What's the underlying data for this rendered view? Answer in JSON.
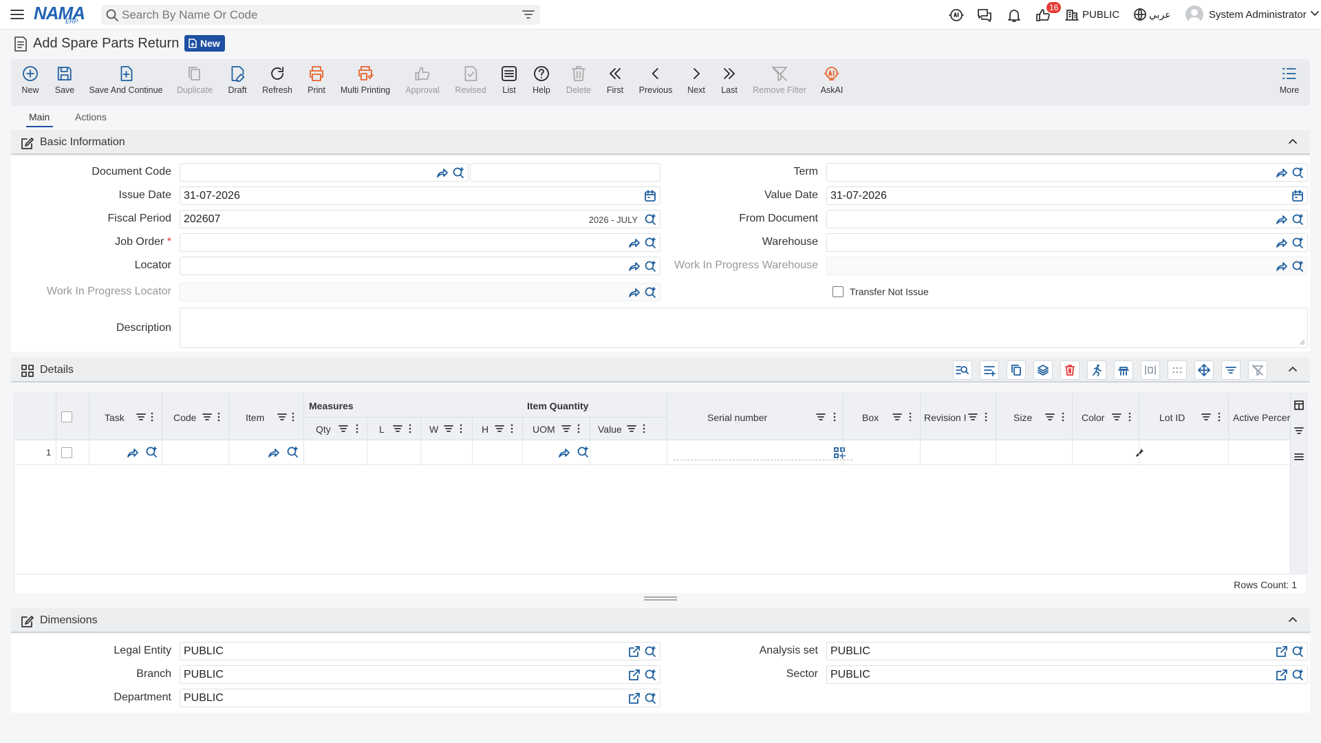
{
  "topbar": {
    "logo_text": "NAMA",
    "logo_sub": "ERP",
    "search_placeholder": "Search By Name Or Code",
    "notification_count": "16",
    "entity_label": "PUBLIC",
    "language_label": "عربي",
    "user_name": "System Administrator"
  },
  "page": {
    "title": "Add Spare Parts Return",
    "status_badge": "New"
  },
  "toolbar": {
    "new": "New",
    "save": "Save",
    "save_continue": "Save And Continue",
    "duplicate": "Duplicate",
    "draft": "Draft",
    "refresh": "Refresh",
    "print": "Print",
    "multi_printing": "Multi Printing",
    "approval": "Approval",
    "revised": "Revised",
    "list": "List",
    "help": "Help",
    "delete": "Delete",
    "first": "First",
    "previous": "Previous",
    "next": "Next",
    "last": "Last",
    "remove_filter": "Remove Filter",
    "askai": "AskAI",
    "more": "More"
  },
  "tabs": {
    "main": "Main",
    "actions": "Actions"
  },
  "basic_info": {
    "title": "Basic Information",
    "document_code_label": "Document Code",
    "document_code": "",
    "issue_date_label": "Issue Date",
    "issue_date": "31-07-2026",
    "fiscal_period_label": "Fiscal Period",
    "fiscal_period": "202607",
    "fiscal_period_desc": "2026 - JULY",
    "job_order_label": "Job Order",
    "required_mark": "*",
    "locator_label": "Locator",
    "wip_locator_label": "Work In Progress Locator",
    "description_label": "Description",
    "term_label": "Term",
    "value_date_label": "Value Date",
    "value_date": "31-07-2026",
    "from_document_label": "From Document",
    "warehouse_label": "Warehouse",
    "wip_warehouse_label": "Work In Progress Warehouse",
    "transfer_not_issue_label": "Transfer Not Issue"
  },
  "details": {
    "title": "Details",
    "columns": {
      "task": "Task",
      "code": "Code",
      "item": "Item",
      "measures": "Measures",
      "qty": "Qty",
      "l": "L",
      "w": "W",
      "h": "H",
      "item_quantity": "Item Quantity",
      "uom": "UOM",
      "value": "Value",
      "serial_number": "Serial number",
      "box": "Box",
      "revision": "Revision I",
      "size": "Size",
      "color": "Color",
      "lot_id": "Lot ID",
      "active_percent": "Active Percer"
    },
    "rows": [
      {
        "num": "1"
      }
    ],
    "rows_count": "Rows Count: 1"
  },
  "dimensions": {
    "title": "Dimensions",
    "legal_entity_label": "Legal Entity",
    "legal_entity": "PUBLIC",
    "branch_label": "Branch",
    "branch": "PUBLIC",
    "department_label": "Department",
    "department": "PUBLIC",
    "analysis_set_label": "Analysis set",
    "analysis_set": "PUBLIC",
    "sector_label": "Sector",
    "sector": "PUBLIC"
  },
  "colors": {
    "primary": "#1e50a2",
    "accent_link": "#1e5f9e",
    "print_orange": "#e8632b",
    "danger": "#e53935"
  }
}
